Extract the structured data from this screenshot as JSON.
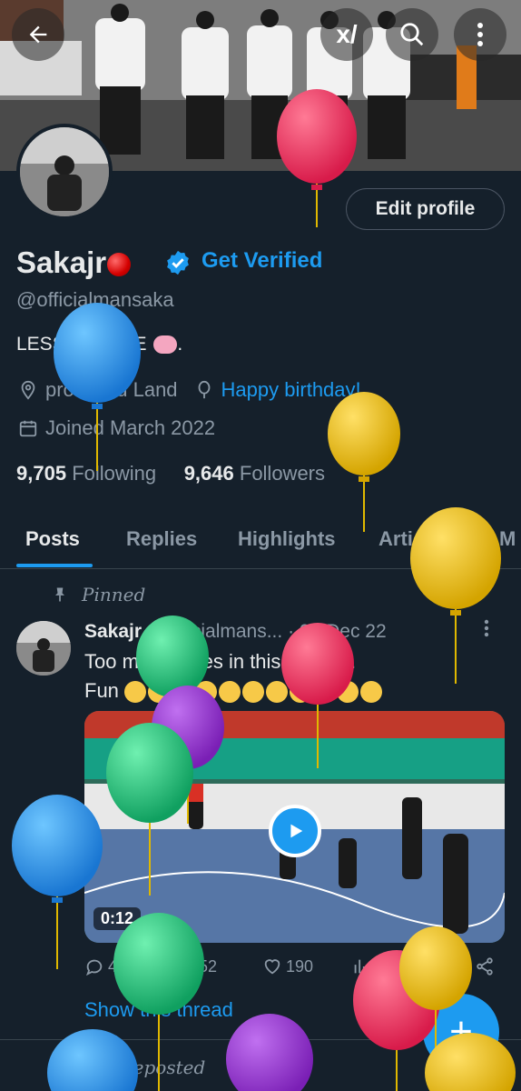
{
  "header": {
    "back_icon": "back-arrow-icon",
    "grok_label": "x/",
    "search_icon": "search-icon",
    "more_icon": "more-vertical-icon"
  },
  "profile": {
    "name": "Sakajr",
    "get_verified": "Get Verified",
    "handle": "@officialmansaka",
    "bio": "LESS is MORE",
    "location": "promised Land",
    "birthday": "Happy birthday!",
    "joined": "Joined March 2022",
    "following_count": "9,705",
    "following_label": "Following",
    "followers_count": "9,646",
    "followers_label": "Followers",
    "edit_button": "Edit profile"
  },
  "tabs": [
    {
      "label": "Posts",
      "active": true
    },
    {
      "label": "Replies",
      "active": false
    },
    {
      "label": "Highlights",
      "active": false
    },
    {
      "label": "Articles",
      "active": false
    },
    {
      "label": "M",
      "active": false
    }
  ],
  "post": {
    "pinned_label": "Pinned",
    "author": "Sakajr",
    "handle": "@officialmans...",
    "date": "· 07 Dec 22",
    "text_line1": "Too much jokes in this country.",
    "text_line2": "Fun",
    "video_duration": "0:12",
    "replies": "42",
    "reposts": "52",
    "likes": "190",
    "show_thread": "Show this thread"
  },
  "next_post": {
    "reposted_label": "You reposted"
  },
  "colors": {
    "background": "#15202b",
    "accent": "#1d9bf0",
    "muted": "#8b98a5",
    "text": "#e7e9ea"
  }
}
